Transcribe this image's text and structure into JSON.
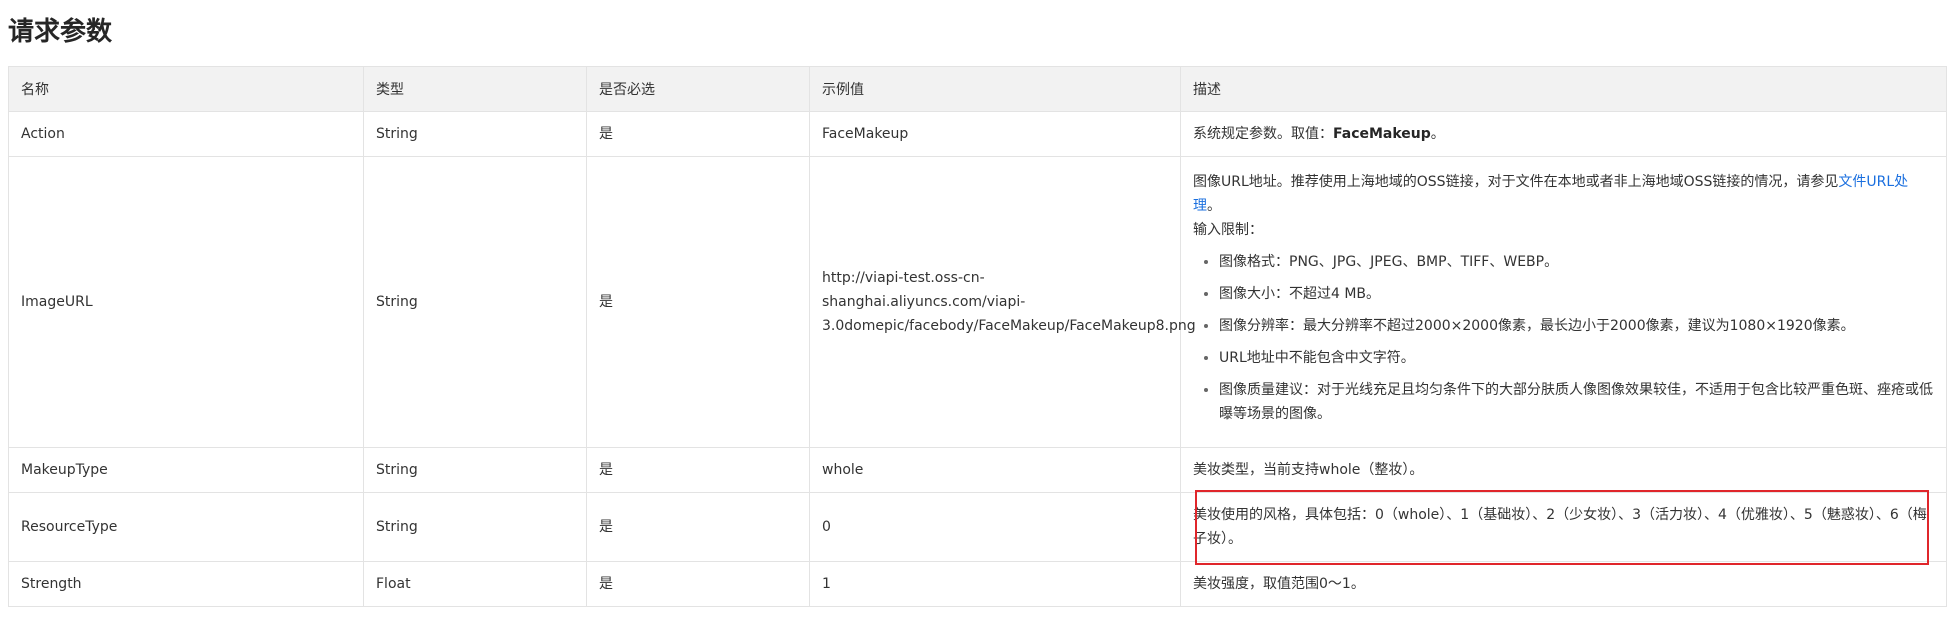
{
  "section": {
    "title": "请求参数"
  },
  "table": {
    "headers": [
      "名称",
      "类型",
      "是否必选",
      "示例值",
      "描述"
    ],
    "rows": {
      "action": {
        "name": "Action",
        "type": "String",
        "required": "是",
        "example": "FaceMakeup",
        "desc_prefix": "系统规定参数。取值：",
        "desc_bold": "FaceMakeup",
        "desc_suffix": "。"
      },
      "imageurl": {
        "name": "ImageURL",
        "type": "String",
        "required": "是",
        "example_line1": "http://viapi-test.oss-cn-shanghai.aliyuncs.com/viapi-",
        "example_line2": "3.0domepic/facebody/FaceMakeup/FaceMakeup8.png",
        "desc_intro": "图像URL地址。推荐使用上海地域的OSS链接，对于文件在本地或者非上海地域OSS链接的情况，请参见",
        "desc_link": "文件URL处理",
        "desc_intro_end": "。",
        "limits_label": "输入限制：",
        "limits": [
          "图像格式：PNG、JPG、JPEG、BMP、TIFF、WEBP。",
          "图像大小：不超过4 MB。",
          "图像分辨率：最大分辨率不超过2000×2000像素，最长边小于2000像素，建议为1080×1920像素。",
          "URL地址中不能包含中文字符。",
          "图像质量建议：对于光线充足且均匀条件下的大部分肤质人像图像效果较佳，不适用于包含比较严重色斑、痤疮或低曝等场景的图像。"
        ]
      },
      "makeup": {
        "name": "MakeupType",
        "type": "String",
        "required": "是",
        "example": "whole",
        "desc": "美妆类型，当前支持whole（整妆）。"
      },
      "resource": {
        "name": "ResourceType",
        "type": "String",
        "required": "是",
        "example": "0",
        "desc": "美妆使用的风格，具体包括：0（whole）、1（基础妆）、2（少女妆）、3（活力妆）、4（优雅妆）、5（魅惑妆）、6（梅子妆）。"
      },
      "strength": {
        "name": "Strength",
        "type": "Float",
        "required": "是",
        "example": "1",
        "desc": "美妆强度，取值范围0～1。"
      }
    }
  },
  "colors": {
    "highlight": "#e0262b",
    "link": "#1a6fdf",
    "header_bg": "#f2f2f2",
    "border": "#e3e3e3"
  }
}
